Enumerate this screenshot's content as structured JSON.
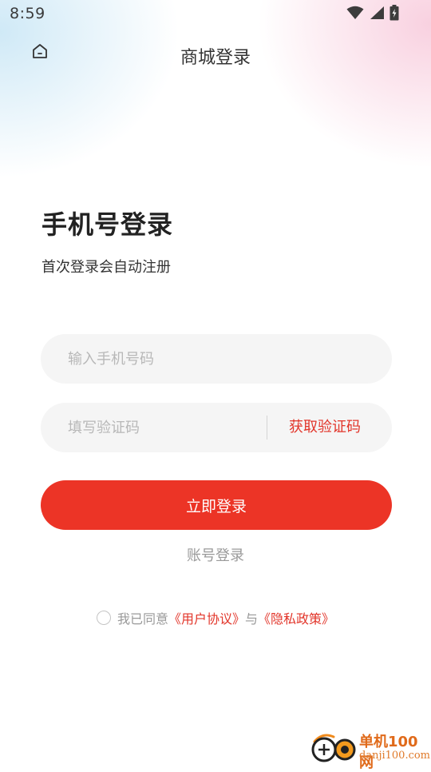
{
  "status_bar": {
    "time": "8:59",
    "icons": [
      "wifi-icon",
      "signal-icon",
      "battery-charging-icon"
    ]
  },
  "header": {
    "title": "商城登录",
    "home_icon": "home-icon"
  },
  "login": {
    "heading": "手机号登录",
    "subtitle": "首次登录会自动注册"
  },
  "form": {
    "phone_placeholder": "输入手机号码",
    "phone_value": "",
    "code_placeholder": "填写验证码",
    "code_value": "",
    "get_code_label": "获取验证码",
    "submit_label": "立即登录",
    "account_login_label": "账号登录"
  },
  "agreement": {
    "prefix": "我已同意",
    "user_agreement": "《用户协议》",
    "connector": "与",
    "privacy_policy": "《隐私政策》",
    "checked": false
  },
  "watermark": {
    "name": "单机100网",
    "domain": "danji100.com"
  },
  "colors": {
    "accent": "#ec3426",
    "link": "#e2352a",
    "input_bg": "#f5f5f5",
    "placeholder": "#b8b8b8"
  }
}
